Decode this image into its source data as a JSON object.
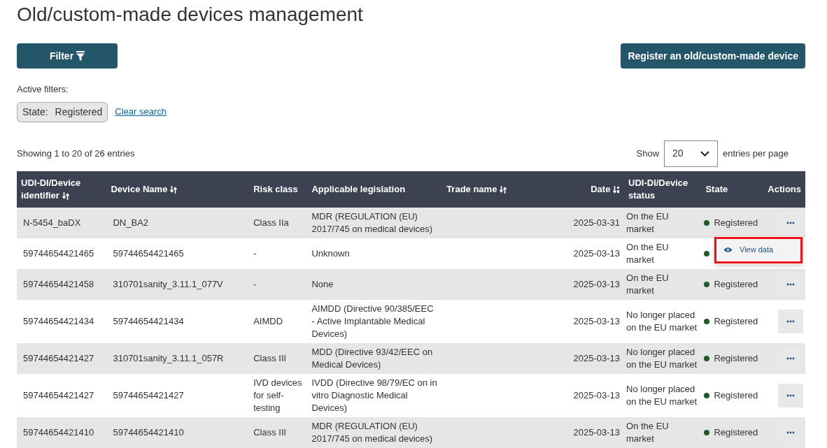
{
  "title": "Old/custom-made devices management",
  "filter_button": {
    "label": "Filter"
  },
  "register_button": {
    "label": "Register an old/custom-made device"
  },
  "active_filters": {
    "label": "Active filters:",
    "chips": [
      {
        "name": "State:",
        "value": "Registered"
      }
    ],
    "clear_link": "Clear search"
  },
  "summary": "Showing 1 to 20 of 26 entries",
  "page_size": {
    "before": "Show",
    "value": "20",
    "after": "entries per page"
  },
  "table": {
    "columns": [
      {
        "label": "UDI-DI/Device identifier",
        "sortable": true,
        "sorted_descending": false
      },
      {
        "label": "Device Name",
        "sortable": true,
        "sorted_descending": false
      },
      {
        "label": "Risk class"
      },
      {
        "label": "Applicable legislation"
      },
      {
        "label": "Trade name",
        "sortable": true,
        "sorted_descending": false
      },
      {
        "label": "Date",
        "sortable": true,
        "sorted_descending": true
      },
      {
        "label": "UDI-DI/Device status"
      },
      {
        "label": "State"
      },
      {
        "label": "Actions"
      }
    ],
    "rows": [
      {
        "cells": [
          "N-5454_baDX",
          "DN_BA2",
          "Class IIa",
          "MDR (REGULATION (EU) 2017/745 on medical devices)",
          "",
          "2025-03-31",
          "On the EU market"
        ],
        "state": {
          "label": "Registered",
          "color": "#1f5a2b"
        },
        "actions_visible": true
      },
      {
        "cells": [
          "59744654421465",
          "59744654421465",
          "-",
          "Unknown",
          "",
          "2025-03-13",
          "On the EU market"
        ],
        "state": {
          "color": "#1f5a2b"
        },
        "actions_visible": false
      },
      {
        "cells": [
          "59744654421458",
          "310701sanity_3.11.1_077V",
          "-",
          "None",
          "",
          "2025-03-13",
          "On the EU market"
        ],
        "state": {
          "label": "Registered",
          "color": "#1f5a2b"
        },
        "actions_visible": true
      },
      {
        "cells": [
          "59744654421434",
          "59744654421434",
          "AIMDD",
          "AIMDD (Directive 90/385/EEC - Active Implantable Medical Devices)",
          "",
          "2025-03-13",
          "No longer placed on the EU market"
        ],
        "state": {
          "label": "Registered",
          "color": "#1f5a2b"
        },
        "actions_visible": true
      },
      {
        "cells": [
          "59744654421427",
          "310701sanity_3.11.1_057R",
          "Class III",
          "MDD (Directive 93/42/EEC on Medical Devices)",
          "",
          "2025-03-13",
          "No longer placed on the EU market"
        ],
        "state": {
          "label": "Registered",
          "color": "#1f5a2b"
        },
        "actions_visible": true
      },
      {
        "cells": [
          "59744654421427",
          "59744654421427",
          "IVD devices for self-testing",
          "IVDD (Directive 98/79/EC on in vitro Diagnostic Medical Devices)",
          "",
          "2025-03-13",
          "No longer placed on the EU market"
        ],
        "state": {
          "label": "Registered",
          "color": "#1f5a2b"
        },
        "actions_visible": true
      },
      {
        "cells": [
          "59744654421410",
          "59744654421410",
          "Class III",
          "MDR (REGULATION (EU) 2017/745 on medical devices)",
          "",
          "2025-03-13",
          "On the EU market"
        ],
        "state": {
          "label": "Registered",
          "color": "#1f5a2b"
        },
        "actions_visible": true
      }
    ]
  },
  "action_menu": {
    "items": [
      {
        "label": "View data",
        "highlighted": true
      }
    ]
  }
}
